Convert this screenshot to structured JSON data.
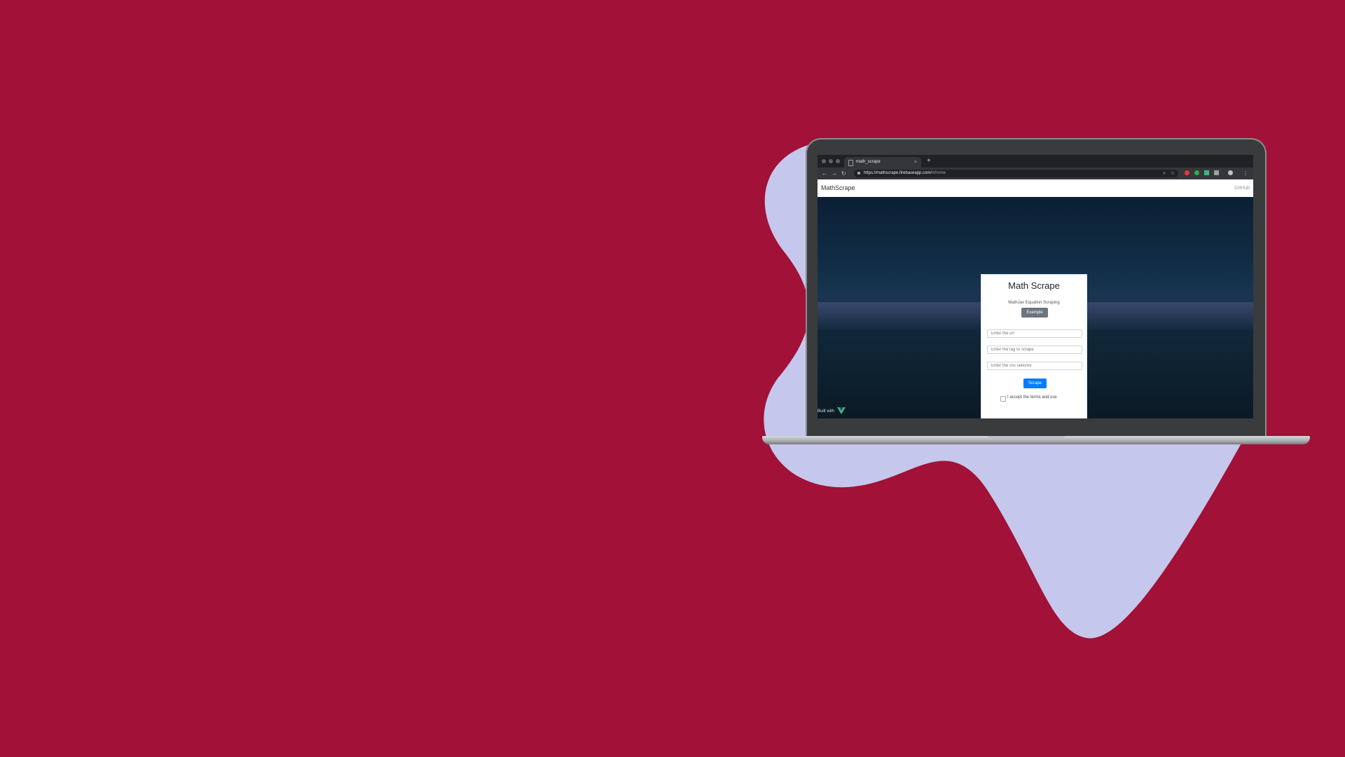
{
  "colors": {
    "background": "#a21137",
    "blob": "#c5c7ec",
    "accent": "#007bff"
  },
  "browser": {
    "tab_title": "math_scrape",
    "tab_close": "×",
    "new_tab": "+",
    "url_main": "https://mathscrape.firebaseapp.com/",
    "url_rest": "#/home",
    "icons": [
      "back-icon",
      "forward-icon",
      "reload-icon",
      "lock-icon",
      "search-icon",
      "star-icon",
      "extension-icon",
      "profile-icon",
      "menu-icon"
    ]
  },
  "app": {
    "brand": "MathScrape",
    "github": "GitHub"
  },
  "card": {
    "title": "Math Scrape",
    "subtitle": "MathJax Equation Scraping",
    "example_button": "Example",
    "url_placeholder": "Enter the url",
    "tag_placeholder": "Enter the tag to scrape",
    "css_placeholder": "Enter the css selector",
    "scrape_button": "Scrape",
    "terms_label": "I accept the terms and use"
  },
  "footer": {
    "built_with": "Built with"
  }
}
